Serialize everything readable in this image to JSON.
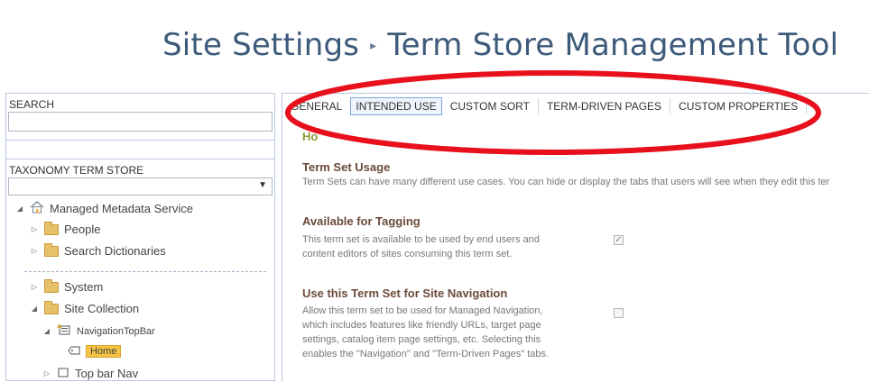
{
  "header": {
    "breadcrumb_part1": "Site Settings",
    "separator": "▸",
    "breadcrumb_part2": "Term Store Management Tool"
  },
  "left_panel": {
    "search_label": "SEARCH",
    "search_value": "",
    "taxonomy_label": "TAXONOMY TERM STORE",
    "taxonomy_selected": "",
    "tree": {
      "root": "Managed Metadata Service",
      "people": "People",
      "search_dictionaries": "Search Dictionaries",
      "system": "System",
      "site_collection": "Site Collection",
      "navigation_top_bar": "NavigationTopBar",
      "home": "Home",
      "top_bar_nav": "Top bar Nav"
    }
  },
  "right_panel": {
    "tabs": [
      "GENERAL",
      "INTENDED USE",
      "CUSTOM SORT",
      "TERM-DRIVEN PAGES",
      "CUSTOM PROPERTIES"
    ],
    "active_tab": "INTENDED USE",
    "partial_title": "Ho",
    "term_set_usage": {
      "title": "Term Set Usage",
      "desc": "Term Sets can have many different use cases. You can hide or display the tabs that users will see when they edit this ter"
    },
    "available_for_tagging": {
      "title": "Available for Tagging",
      "desc_line1": "This term set is available to be used by end users and",
      "desc_line2": "content editors of sites consuming this term set.",
      "checked": true
    },
    "site_navigation": {
      "title": "Use this Term Set for Site Navigation",
      "desc_line1": "Allow this term set to be used for Managed Navigation,",
      "desc_line2": "which includes features like friendly URLs, target page",
      "desc_line3": "settings, catalog item page settings, etc. Selecting this",
      "desc_line4": "enables the \"Navigation\" and \"Term-Driven Pages\" tabs.",
      "checked": false
    }
  },
  "colors": {
    "title": "#3d5a7a",
    "annotation": "#e8101c",
    "section_heading": "#6b4a3a",
    "highlight": "#f6c444"
  }
}
